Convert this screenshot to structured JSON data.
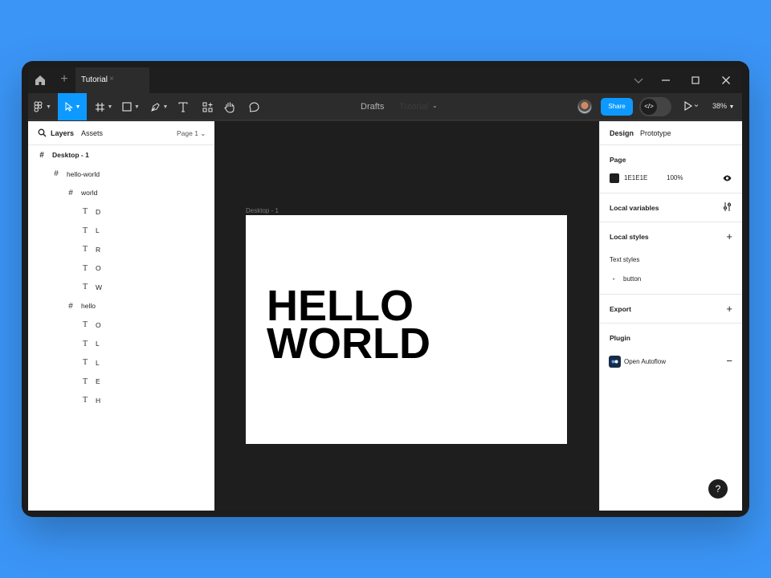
{
  "tabbar": {
    "tab_label": "Tutorial",
    "tab_close": "×",
    "new_tab": "+"
  },
  "toolbar": {
    "location": "Drafts",
    "file_name": "Tutorial",
    "title_caret": "⌄",
    "share_label": "Share",
    "dev_mode_icon": "</>",
    "zoom": "38%"
  },
  "left_panel": {
    "tabs": [
      "Layers",
      "Assets"
    ],
    "page_selector": "Page 1 ⌄",
    "layers": [
      {
        "name": "Desktop - 1",
        "type": "frame",
        "depth": 0
      },
      {
        "name": "hello-world",
        "type": "frame",
        "depth": 1
      },
      {
        "name": "world",
        "type": "frame",
        "depth": 2
      },
      {
        "name": "D",
        "type": "text",
        "depth": 3
      },
      {
        "name": "L",
        "type": "text",
        "depth": 3
      },
      {
        "name": "R",
        "type": "text",
        "depth": 3
      },
      {
        "name": "O",
        "type": "text",
        "depth": 3
      },
      {
        "name": "W",
        "type": "text",
        "depth": 3
      },
      {
        "name": "hello",
        "type": "frame",
        "depth": 2
      },
      {
        "name": "O",
        "type": "text",
        "depth": 3
      },
      {
        "name": "L",
        "type": "text",
        "depth": 3
      },
      {
        "name": "L",
        "type": "text",
        "depth": 3
      },
      {
        "name": "E",
        "type": "text",
        "depth": 3
      },
      {
        "name": "H",
        "type": "text",
        "depth": 3
      }
    ]
  },
  "canvas": {
    "frame_label": "Desktop - 1",
    "text_line1": "HELLO",
    "text_line2": "WORLD",
    "background": "#1E1E1E"
  },
  "right_panel": {
    "tabs": [
      "Design",
      "Prototype"
    ],
    "page_section": "Page",
    "page_color": "1E1E1E",
    "page_opacity": "100%",
    "local_variables": "Local variables",
    "local_styles": "Local styles",
    "text_styles": "Text styles",
    "style_item": "button",
    "export": "Export",
    "plugin": "Plugin",
    "plugin_name": "Open Autoflow",
    "help": "?"
  },
  "colors": {
    "accent": "#0D99FF",
    "desktop_bg": "#3B95F6"
  }
}
